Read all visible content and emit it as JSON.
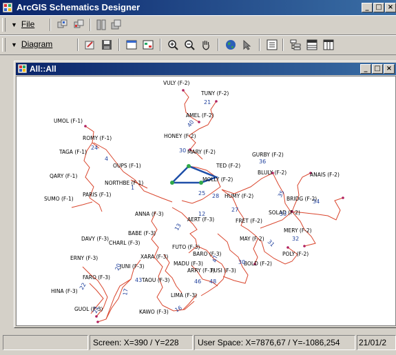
{
  "app": {
    "title": "ArcGIS Schematics Designer",
    "min_glyph": "_",
    "max_glyph": "□",
    "close_glyph": "×"
  },
  "menus": {
    "file_label": "File",
    "diagram_label": "Diagram"
  },
  "toolbar_icons": {
    "file_row": [
      "new-diagram-icon",
      "open-diagram-icon",
      "properties-icon",
      "save-icon"
    ],
    "diagram_row": [
      "edit-icon",
      "save-diagram-icon",
      "layout-icon",
      "attributes-icon",
      "zoom-in-icon",
      "zoom-out-icon",
      "pan-icon",
      "globe-icon",
      "select-icon",
      "list-icon",
      "tree-icon",
      "table-icon",
      "columns-icon"
    ]
  },
  "child_window": {
    "title": "All::All"
  },
  "diagram": {
    "labels": {
      "vuly": "VULY (F-2)",
      "tuny": "TUNY (F-2)",
      "amel": "AMEL (F-2)",
      "umol": "UMOL (F-1)",
      "honey": "HONEY (F-2)",
      "romy": "ROMY (F-1)",
      "taga": "TAGA (F-1)",
      "mary": "MARY (F-2)",
      "gurby": "GURBY (F-2)",
      "oups": "OUPS (F-1)",
      "ted": "TED (F-2)",
      "bluly": "BLULY (F-2)",
      "anais": "ANAIS (F-2)",
      "qary": "QARY (F-1)",
      "molly": "MOLLY (F-2)",
      "north": "NORTHBE (F-1)",
      "paris": "PARIS (F-1)",
      "sumo": "SUMO (F-1)",
      "humy": "HUMY (F-2)",
      "bridg": "BRIDG (F-2)",
      "solad": "SOLAD (F-2)",
      "anna": "ANNA (F-3)",
      "aert": "AERT (F-3)",
      "fret": "FRET (F-2)",
      "mery": "MERY (F-2)",
      "babe": "BABE (F-3)",
      "davy": "DAVY (F-3)",
      "charl": "CHARL (F-3)",
      "may": "MAY (F-2)",
      "futo": "FUTO (F-3)",
      "erny": "ERNY (F-3)",
      "baro": "BARO (F-3)",
      "poly": "POLY (F-2)",
      "xara": "XARA (F-3)",
      "juni": "JUNI (F-3)",
      "madu": "MADU (F-3)",
      "bold": "BOLD (F-2)",
      "arry": "ARRY (F-3)",
      "fusi": "FUSI (F-3)",
      "faro": "FARO (F-3)",
      "taou": "TAOU (F-3)",
      "hina": "HINA (F-3)",
      "lima": "LIMA (F-3)",
      "guol": "GUOL (F-3)",
      "kawo": "KAWO (F-3)"
    },
    "numbers": [
      "21",
      "40",
      "4",
      "30",
      "12",
      "25",
      "28",
      "27",
      "35",
      "33",
      "34",
      "36",
      "24",
      "1",
      "13",
      "32",
      "31",
      "30",
      "47",
      "46",
      "48",
      "43",
      "17",
      "16",
      "21",
      "22",
      "20"
    ]
  },
  "status": {
    "screen": "Screen: X=390 / Y=228",
    "user_space": "User Space: X=7876,67 / Y=-1086,254",
    "date": "21/01/2"
  },
  "colors": {
    "titlebar_start": "#0a246a",
    "titlebar_end": "#3a6ea5",
    "link": "#d9442b",
    "selected_link": "#1f4fa8",
    "number": "#1e3f9c",
    "node_green": "#2fa84a"
  }
}
